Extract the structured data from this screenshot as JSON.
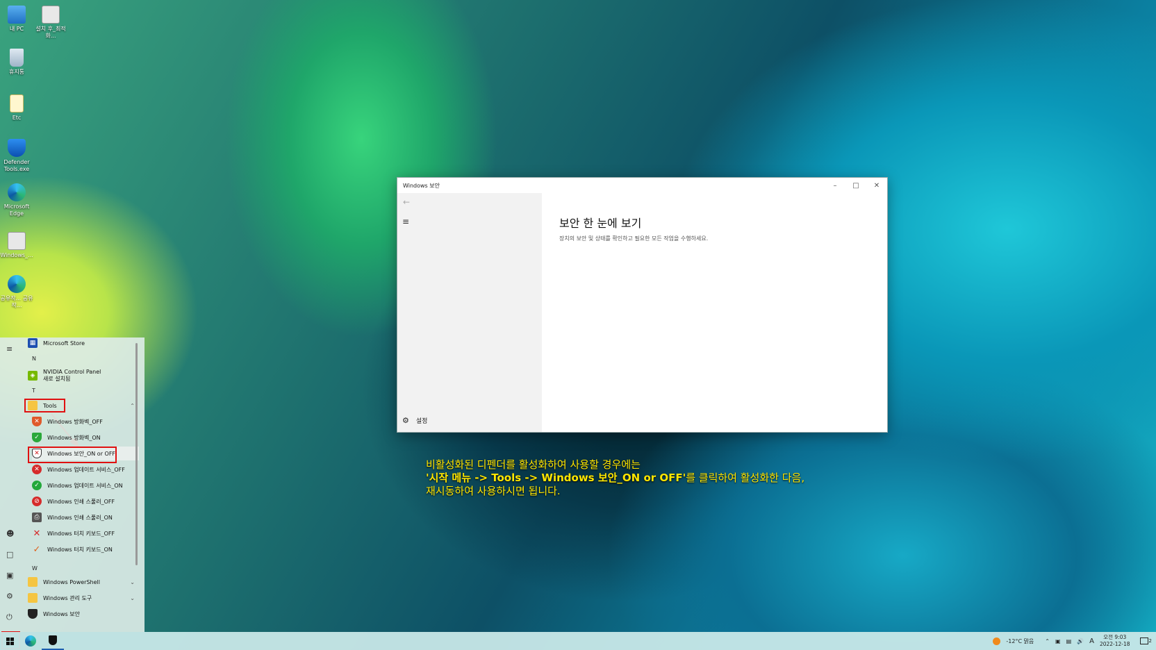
{
  "desktop": {
    "icons": [
      {
        "label": "내 PC"
      },
      {
        "label": "설치 후_최적화..."
      },
      {
        "label": "휴지통"
      },
      {
        "label": "Etc"
      },
      {
        "label": "Defender Tools.exe"
      },
      {
        "label": "Microsoft Edge"
      },
      {
        "label": "Windows_..."
      },
      {
        "label": "공유작... 공유작..."
      }
    ]
  },
  "window": {
    "title": "Windows 보안",
    "heading": "보안 한 눈에 보기",
    "subtitle": "장치의 보안 및 상태를 확인하고 필요한 모든 작업을 수행하세요.",
    "settings_label": "설정"
  },
  "instruction": {
    "line1": "비활성화된 디펜더를 활성화하여 사용할 경우에는",
    "line2_a": "'시작 메뉴 -> Tools -> Windows 보안_ON or OFF'",
    "line2_b": "를 클릭하여 활성화한 다음,",
    "line3": "재시동하여 사용하시면 됩니다."
  },
  "start_menu": {
    "items": [
      {
        "label": "Microsoft Store"
      },
      {
        "letter": "N"
      },
      {
        "label": "NVIDIA Control Panel",
        "sublabel": "새로 설치됨"
      },
      {
        "letter": "T"
      },
      {
        "label": "Tools"
      },
      {
        "label": "Windows 방화벽_OFF"
      },
      {
        "label": "Windows 방화벽_ON"
      },
      {
        "label": "Windows 보안_ON or OFF"
      },
      {
        "label": "Windows 업데이트 서비스_OFF"
      },
      {
        "label": "Windows 업데이트 서비스_ON"
      },
      {
        "label": "Windows 인쇄 스풀러_OFF"
      },
      {
        "label": "Windows 인쇄 스풀러_ON"
      },
      {
        "label": "Windows 터치 키보드_OFF"
      },
      {
        "label": "Windows 터치 키보드_ON"
      },
      {
        "letter": "W"
      },
      {
        "label": "Windows PowerShell"
      },
      {
        "label": "Windows 관리 도구"
      },
      {
        "label": "Windows 보안"
      }
    ]
  },
  "taskbar": {
    "weather": "-12°C  맑음",
    "ime": "A",
    "time": "오전 9:03",
    "date": "2022-12-18",
    "notification_count": "2"
  }
}
